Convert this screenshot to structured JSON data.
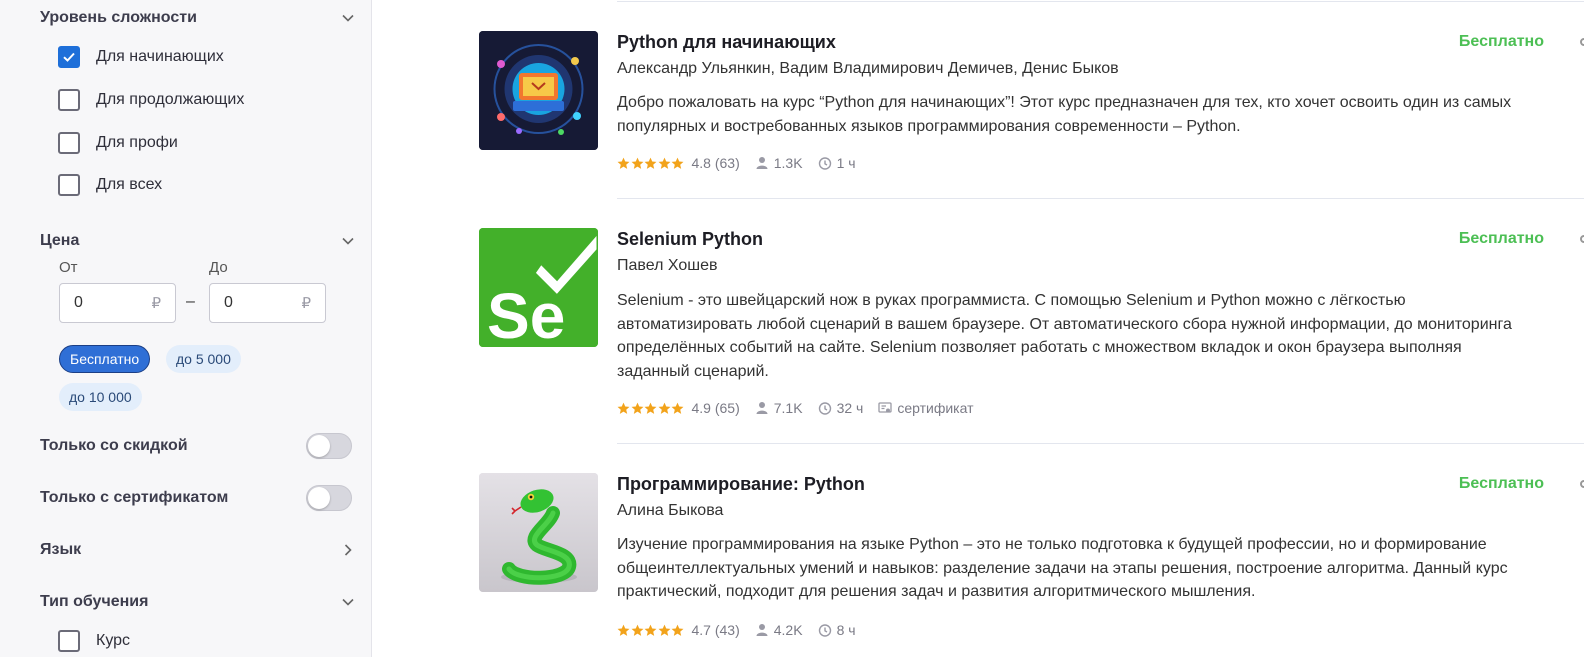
{
  "sidebar": {
    "level": {
      "title": "Уровень сложности",
      "options": [
        {
          "label": "Для начинающих",
          "checked": true
        },
        {
          "label": "Для продолжающих",
          "checked": false
        },
        {
          "label": "Для профи",
          "checked": false
        },
        {
          "label": "Для всех",
          "checked": false
        }
      ]
    },
    "price": {
      "title": "Цена",
      "from_label": "От",
      "to_label": "До",
      "from_value": "0",
      "to_value": "0",
      "currency": "₽",
      "separator": "–",
      "chips": [
        {
          "label": "Бесплатно",
          "active": true
        },
        {
          "label": "до 5 000",
          "active": false
        },
        {
          "label": "до 10 000",
          "active": false
        }
      ]
    },
    "discount_only": {
      "label": "Только со скидкой",
      "on": false
    },
    "certificate_only": {
      "label": "Только с сертификатом",
      "on": false
    },
    "language": {
      "title": "Язык"
    },
    "learning_type": {
      "title": "Тип обучения",
      "options": [
        {
          "label": "Курс",
          "checked": false
        }
      ]
    }
  },
  "courses": [
    {
      "title": "Python для начинающих",
      "authors": "Александр Ульянкин, Вадим Владимирович Демичев, Денис Быков",
      "description": "Добро пожаловать на курс “Python для начинающих”! Этот курс предназначен для тех, кто хочет освоить один из самых популярных и востребованных языков программирования современности – Python.",
      "price": "Бесплатно",
      "rating": "4.8 (63)",
      "students": "1.3K",
      "duration": "1 ч",
      "certificate": ""
    },
    {
      "title": "Selenium Python",
      "authors": "Павел Хошев",
      "description": "Selenium - это швейцарский нож в руках программиста. С помощью Selenium и Python можно с лёгкостью автоматизировать любой сценарий в вашем браузере. От автоматического сбора нужной информации, до мониторинга определённых событий на сайте. Selenium позволяет работать с множеством вкладок и окон браузера выполняя заданный сценарий.",
      "price": "Бесплатно",
      "rating": "4.9 (65)",
      "students": "7.1K",
      "duration": "32 ч",
      "certificate": "сертификат",
      "logo_text": "Se"
    },
    {
      "title": "Программирование: Python",
      "authors": "Алина Быкова",
      "description": "Изучение программирования на языке Python – это не только подготовка к будущей профессии, но и формирование общеинтеллектуальных умений и навыков: разделение задачи на этапы решения, построение алгоритма. Данный курс практический, подходит для решения задач и развития алгоритмического мышления.",
      "price": "Бесплатно",
      "rating": "4.7 (43)",
      "students": "4.2K",
      "duration": "8 ч",
      "certificate": ""
    }
  ],
  "colors": {
    "accent": "#1e6fd9",
    "price_free": "#4cbf54",
    "star": "#f2a31b",
    "selenium_green": "#43b02a"
  },
  "icons": {
    "chevron_down": "chevron-down-icon",
    "chevron_right": "chevron-right-icon",
    "check": "check-icon",
    "star": "star-icon",
    "user": "user-icon",
    "clock": "clock-icon",
    "certificate": "certificate-icon"
  }
}
